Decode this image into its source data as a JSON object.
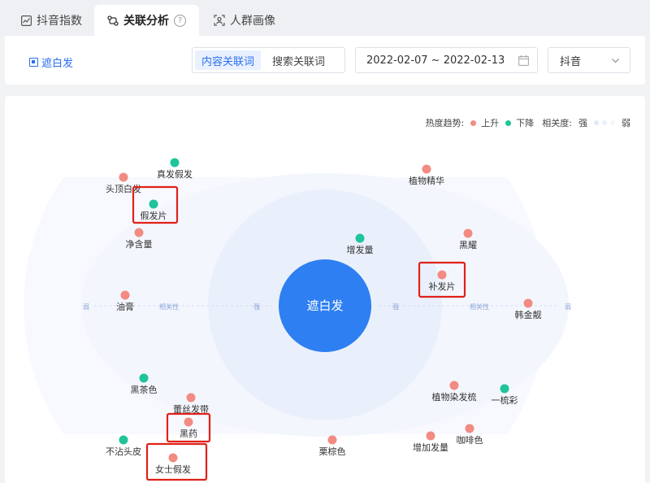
{
  "tabs": [
    {
      "label": "抖音指数",
      "icon": "trend-chart-icon"
    },
    {
      "label": "关联分析",
      "icon": "relation-icon",
      "help": "?"
    },
    {
      "label": "人群画像",
      "icon": "user-scan-icon"
    }
  ],
  "filter": {
    "keyword": "遮白发",
    "segments": [
      "内容关联词",
      "搜索关联词"
    ],
    "active_segment": "内容关联词",
    "date_range": "2022-02-07 ~ 2022-02-13",
    "platform": "抖音"
  },
  "legend": {
    "trend_label": "热度趋势:",
    "up": "上升",
    "down": "下降",
    "relevance_label": "相关度:",
    "strong": "强",
    "weak": "弱"
  },
  "colors": {
    "up": "#f28b82",
    "down": "#1fc49a",
    "accent": "#2b6ff2",
    "center": "#2e7ff2"
  },
  "graph": {
    "center": "遮白发",
    "axis": {
      "weak": "弱",
      "relevance": "相关性",
      "strong": "强"
    },
    "nodes": [
      {
        "label": "真发假发",
        "trend": "down"
      },
      {
        "label": "头顶白发",
        "trend": "up"
      },
      {
        "label": "假发片",
        "trend": "down",
        "highlight": true
      },
      {
        "label": "净含量",
        "trend": "up"
      },
      {
        "label": "油膏",
        "trend": "up"
      },
      {
        "label": "植物精华",
        "trend": "up"
      },
      {
        "label": "黑耀",
        "trend": "up"
      },
      {
        "label": "增发量",
        "trend": "down"
      },
      {
        "label": "补发片",
        "trend": "up",
        "highlight": true
      },
      {
        "label": "韩金靓",
        "trend": "up"
      },
      {
        "label": "黑茶色",
        "trend": "down"
      },
      {
        "label": "蕾丝发带",
        "trend": "up"
      },
      {
        "label": "黑药",
        "trend": "up",
        "highlight": true
      },
      {
        "label": "不沾头皮",
        "trend": "down"
      },
      {
        "label": "女士假发",
        "trend": "up",
        "highlight": true
      },
      {
        "label": "栗棕色",
        "trend": "up"
      },
      {
        "label": "增加发量",
        "trend": "up"
      },
      {
        "label": "咖啡色",
        "trend": "up"
      },
      {
        "label": "植物染发梳",
        "trend": "up"
      },
      {
        "label": "一梳彩",
        "trend": "down"
      }
    ]
  }
}
